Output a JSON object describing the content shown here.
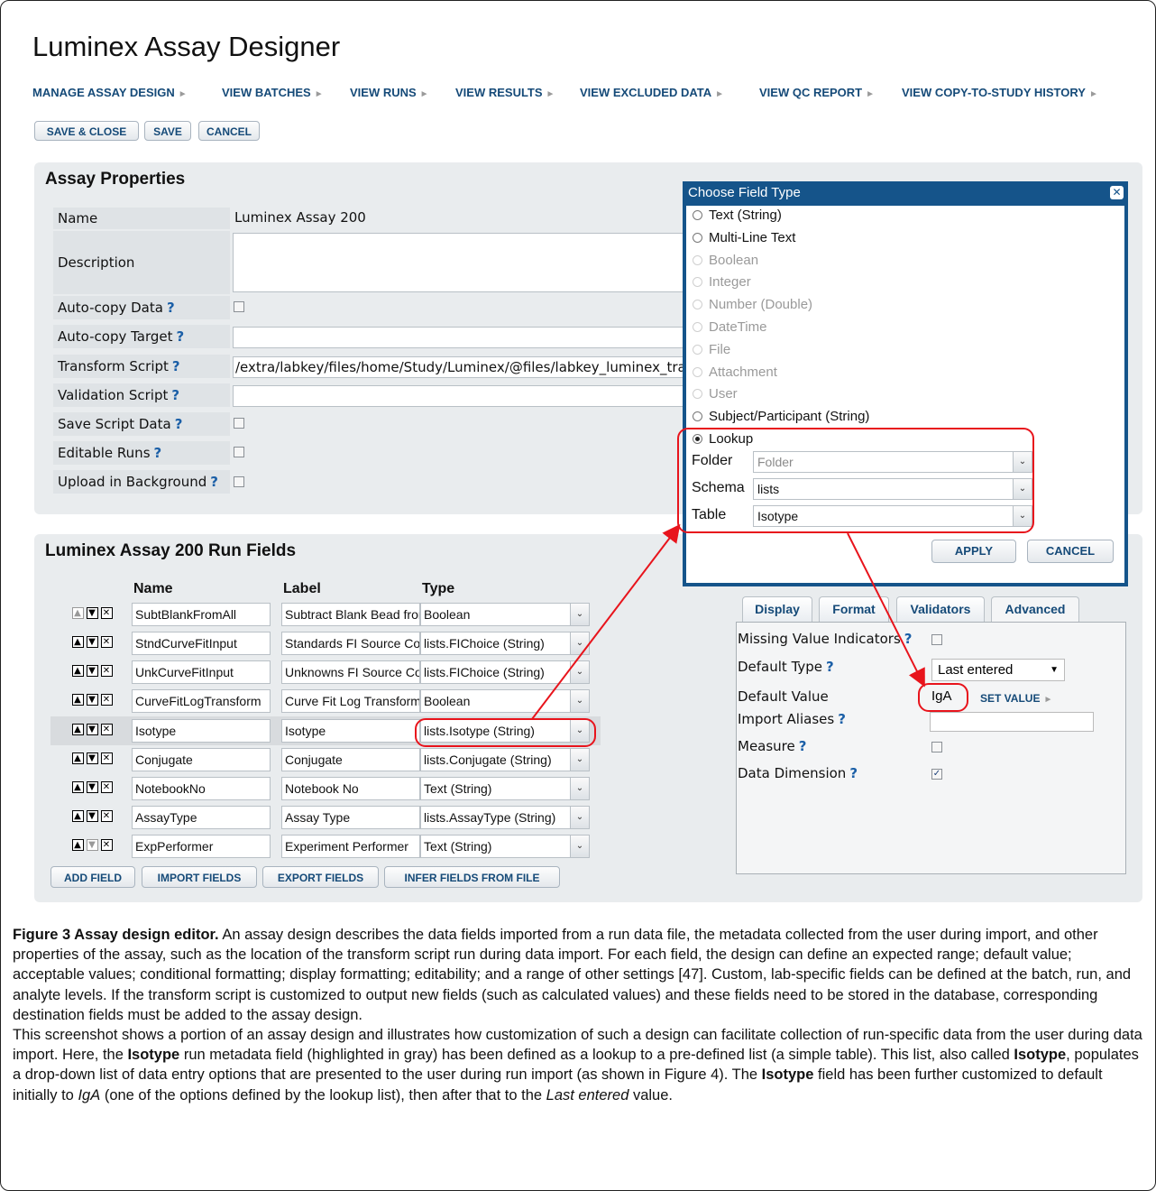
{
  "app": {
    "title": "Luminex Assay Designer"
  },
  "nav": [
    "MANAGE ASSAY DESIGN",
    "VIEW BATCHES",
    "VIEW RUNS",
    "VIEW RESULTS",
    "VIEW EXCLUDED DATA",
    "VIEW QC REPORT",
    "VIEW COPY-TO-STUDY HISTORY"
  ],
  "toolbar": {
    "save_close": "SAVE & CLOSE",
    "save": "SAVE",
    "cancel": "CANCEL"
  },
  "assay_properties": {
    "title": "Assay Properties",
    "q": "?",
    "labels": {
      "name": "Name",
      "description": "Description",
      "auto_copy_data": "Auto-copy Data",
      "auto_copy_target": "Auto-copy Target",
      "transform_script": "Transform Script",
      "validation_script": "Validation Script",
      "save_script_data": "Save Script Data",
      "editable_runs": "Editable Runs",
      "upload_background": "Upload in Background"
    },
    "values": {
      "name": "Luminex Assay 200",
      "transform_script": "/extra/labkey/files/home/Study/Luminex/@files/labkey_luminex_transform.R"
    }
  },
  "run_fields": {
    "title": "Luminex Assay 200 Run Fields",
    "columns": {
      "name": "Name",
      "label": "Label",
      "type": "Type"
    },
    "rows": [
      {
        "name": "SubtBlankFromAll",
        "label": "Subtract Blank Bead from All",
        "type": "Boolean"
      },
      {
        "name": "StndCurveFitInput",
        "label": "Standards FI Source Column",
        "type": "lists.FIChoice (String)"
      },
      {
        "name": "UnkCurveFitInput",
        "label": "Unknowns FI Source Column",
        "type": "lists.FIChoice (String)"
      },
      {
        "name": "CurveFitLogTransform",
        "label": "Curve Fit Log Transform",
        "type": "Boolean"
      },
      {
        "name": "Isotype",
        "label": "Isotype",
        "type": "lists.Isotype (String)"
      },
      {
        "name": "Conjugate",
        "label": "Conjugate",
        "type": "lists.Conjugate (String)"
      },
      {
        "name": "NotebookNo",
        "label": "Notebook No",
        "type": "Text (String)"
      },
      {
        "name": "AssayType",
        "label": "Assay Type",
        "type": "lists.AssayType (String)"
      },
      {
        "name": "ExpPerformer",
        "label": "Experiment Performer",
        "type": "Text (String)"
      }
    ],
    "buttons": {
      "add": "ADD FIELD",
      "import": "IMPORT FIELDS",
      "export": "EXPORT FIELDS",
      "infer": "INFER FIELDS FROM FILE"
    }
  },
  "tabs": {
    "display": "Display",
    "format": "Format",
    "validators": "Validators",
    "advanced": "Advanced"
  },
  "advanced": {
    "missing_value": "Missing Value Indicators",
    "default_type": "Default Type",
    "default_type_value": "Last entered",
    "default_value": "Default Value",
    "default_value_value": "IgA",
    "set_value": "SET VALUE",
    "import_aliases": "Import Aliases",
    "measure": "Measure",
    "data_dimension": "Data Dimension"
  },
  "dialog": {
    "title": "Choose Field Type",
    "types": [
      "Text (String)",
      "Multi-Line Text",
      "Boolean",
      "Integer",
      "Number (Double)",
      "DateTime",
      "File",
      "Attachment",
      "User",
      "Subject/Participant (String)",
      "Lookup"
    ],
    "folder_label": "Folder",
    "folder_value": "Folder",
    "schema_label": "Schema",
    "schema_value": "lists",
    "table_label": "Table",
    "table_value": "Isotype",
    "apply": "APPLY",
    "cancel": "CANCEL"
  },
  "caption": {
    "fig": "Figure 3 Assay design editor.",
    "p1": "An assay design describes the data fields imported from a run data file, the metadata collected from the user during import, and other properties of the assay, such as the location of the transform script run during data import. For each field, the design can define an expected range; default value; acceptable values; conditional formatting; display formatting; editability; and a range of other settings [47]. Custom, lab-specific fields can be defined at the batch, run, and analyte levels. If the transform script is customized to output new fields (such as calculated values) and these fields need to be stored in the database, corresponding destination fields must be added to the assay design.",
    "p2a": "This screenshot shows a portion of an assay design and illustrates how customization of such a design can facilitate collection of run-specific data from the user during data import. Here, the ",
    "isotype": "Isotype",
    "p2b": " run metadata field (highlighted in gray) has been defined as a lookup to a pre-defined list (a simple table). This list, also called ",
    "p2c": ", populates a drop-down list of data entry options that are presented to the user during run import (as shown in Figure 4). The ",
    "p2d": " field has been further customized to default initially to ",
    "iga": "IgA",
    "p2e": " (one of the options defined by the lookup list), then after that to the ",
    "last_entered": "Last entered",
    "p2f": " value."
  }
}
